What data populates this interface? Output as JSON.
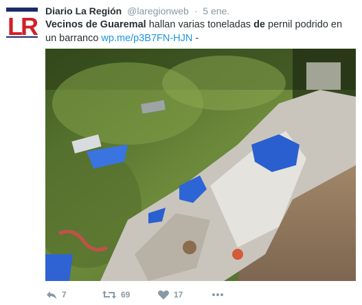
{
  "tweet": {
    "author_name": "Diario La Región",
    "handle": "@laregionweb",
    "separator": "·",
    "time": "5 ene.",
    "text": {
      "part1": "Vecinos de Guaremal",
      "part2": " hallan varias toneladas ",
      "part3": "de",
      "part4": " pernil podrido en un barranco ",
      "link": "wp.me/p3B7FN-HJN",
      "part5": "  -"
    },
    "logo_text": "LR",
    "media_icon": "photo-trash-in-ravine"
  },
  "actions": {
    "reply_count": "7",
    "retweet_count": "69",
    "like_count": "17",
    "more_icon": "more-icon"
  },
  "colors": {
    "link": "#1b95e0",
    "meta": "#8899a6",
    "logo_red": "#d22027",
    "logo_blue": "#1c2a6b"
  }
}
